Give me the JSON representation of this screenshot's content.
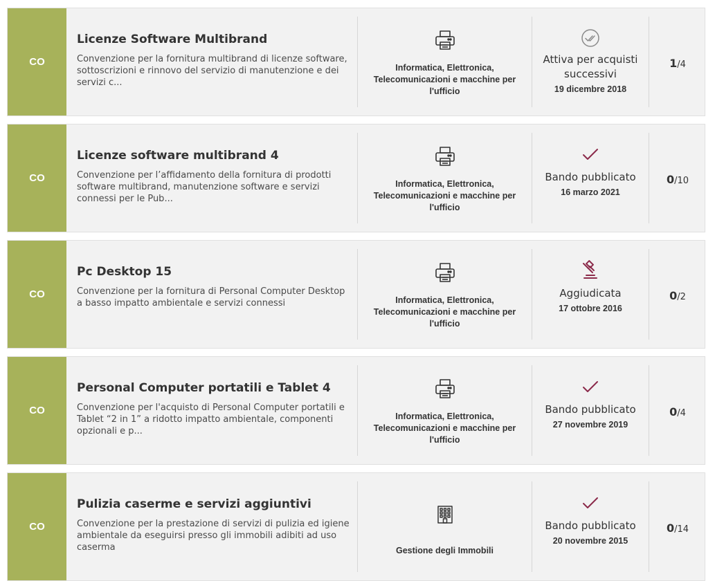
{
  "badge_label": "CO",
  "items": [
    {
      "title": "Licenze Software Multibrand",
      "description": "Convenzione per la fornitura multibrand di licenze software, sottoscrizioni e rinnovo del servizio di manutenzione e dei servizi c...",
      "category": "Informatica, Elettronica, Telecomunicazioni e macchine per l'ufficio",
      "category_icon": "printer-icon",
      "status": "Attiva per acquisti successivi",
      "status_icon": "double-check-circle-icon",
      "date": "19 dicembre 2018",
      "count": "1",
      "total": "/4"
    },
    {
      "title": "Licenze software multibrand 4",
      "description": "Convenzione per l’affidamento della fornitura di prodotti software multibrand, manutenzione software e servizi connessi per le Pub...",
      "category": "Informatica, Elettronica, Telecomunicazioni e macchine per l'ufficio",
      "category_icon": "printer-icon",
      "status": "Bando pubblicato",
      "status_icon": "check-icon",
      "date": "16 marzo 2021",
      "count": "0",
      "total": "/10"
    },
    {
      "title": "Pc Desktop 15",
      "description": "Convenzione per la fornitura di Personal Computer Desktop a basso impatto ambientale e servizi connessi",
      "category": "Informatica, Elettronica, Telecomunicazioni e macchine per l'ufficio",
      "category_icon": "printer-icon",
      "status": "Aggiudicata",
      "status_icon": "gavel-icon",
      "date": "17 ottobre 2016",
      "count": "0",
      "total": "/2"
    },
    {
      "title": "Personal Computer portatili e Tablet 4",
      "description": "Convenzione per l'acquisto di Personal Computer portatili e Tablet “2 in 1” a ridotto impatto ambientale, componenti opzionali e p...",
      "category": "Informatica, Elettronica, Telecomunicazioni e macchine per l'ufficio",
      "category_icon": "printer-icon",
      "status": "Bando pubblicato",
      "status_icon": "check-icon",
      "date": "27 novembre 2019",
      "count": "0",
      "total": "/4"
    },
    {
      "title": "Pulizia caserme e servizi aggiuntivi",
      "description": "Convenzione per la prestazione di servizi di pulizia ed igiene ambientale da eseguirsi presso gli immobili adibiti ad uso caserma",
      "category": "Gestione degli Immobili",
      "category_icon": "building-icon",
      "status": "Bando pubblicato",
      "status_icon": "check-icon",
      "date": "20 novembre 2015",
      "count": "0",
      "total": "/14"
    }
  ],
  "colors": {
    "badge": "#a7b25a",
    "card_bg": "#f2f2f2",
    "accent": "#8b2a4a",
    "muted_icon": "#8a8a8a"
  }
}
